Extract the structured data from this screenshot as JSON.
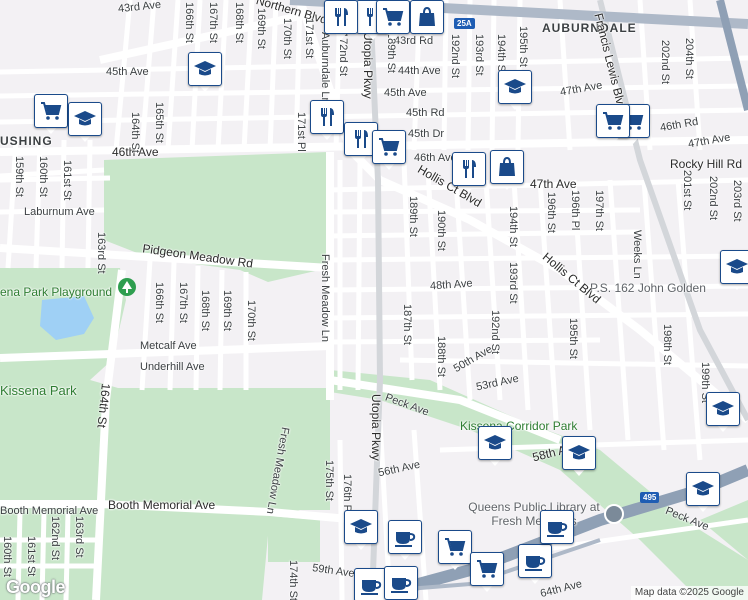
{
  "map": {
    "areas": [
      "AUBURNDALE",
      "USHING"
    ],
    "parks": [
      "ena Park Playground",
      "Kissena Park",
      "Kissena Corridor Park"
    ],
    "pois": [
      "P.S. 162 John Golden",
      "Queens Public Library at Fresh Meadows"
    ],
    "streets": {
      "avenues": [
        "43rd Ave",
        "45th Ave",
        "44th Ave",
        "43rd Rd",
        "45th Ave",
        "45th Rd",
        "45th Dr",
        "46th Ave",
        "46th Ave",
        "47th Ave",
        "47th Ave",
        "47th Ave",
        "46th Rd",
        "Laburnum Ave",
        "Pidgeon Meadow Rd",
        "48th Ave",
        "Metcalf Ave",
        "Underhill Ave",
        "50th Ave",
        "53rd Ave",
        "Peck Ave",
        "56th Ave",
        "58th Ave",
        "Booth Memorial Ave",
        "Peck Ave",
        "59th Ave",
        "64th Ave",
        "Rocky Hill Rd",
        "Hollis Ct Blvd",
        "Hollis Ct Blvd",
        "Northern Blvd"
      ],
      "streets": [
        "166th St",
        "167th St",
        "168th St",
        "169th St",
        "170th St",
        "171st St",
        "171st Pl",
        "Auburndale Ln",
        "172nd St",
        "Utopia Pkwy",
        "189th St",
        "192nd St",
        "193rd St",
        "194th St",
        "195th St",
        "Francis Lewis Blvd",
        "202nd St",
        "204th St",
        "159th St",
        "160th St",
        "161st St",
        "163rd St",
        "164th St",
        "165th St",
        "166th St",
        "167th St",
        "168th St",
        "169th St",
        "170th St",
        "Fresh Meadow Ln",
        "187th St",
        "188th St",
        "189th St",
        "190th St",
        "192nd St",
        "193rd St",
        "194th St",
        "195th St",
        "196th St",
        "196th Pl",
        "197th St",
        "198th St",
        "199th St",
        "201st St",
        "202nd St",
        "203rd St",
        "Weeks Ln",
        "164th St",
        "Utopia Pkwy",
        "Fresh Meadow Ln",
        "175th St",
        "176th Pl",
        "174th St",
        "160th St",
        "161st St",
        "162nd St",
        "163rd St"
      ]
    },
    "shields": [
      "25A",
      "495"
    ],
    "markers": [
      "school",
      "food",
      "grocery",
      "school",
      "food",
      "grocery",
      "food",
      "grocery",
      "food",
      "bag",
      "food",
      "bag",
      "grocery",
      "school",
      "school",
      "school",
      "school",
      "school",
      "school",
      "coffee",
      "school",
      "grocery",
      "grocery",
      "coffee",
      "coffee",
      "grocery",
      "coffee",
      "coffee"
    ],
    "footer": {
      "logo": "Google",
      "attribution": "Map data ©2025 Google"
    }
  }
}
